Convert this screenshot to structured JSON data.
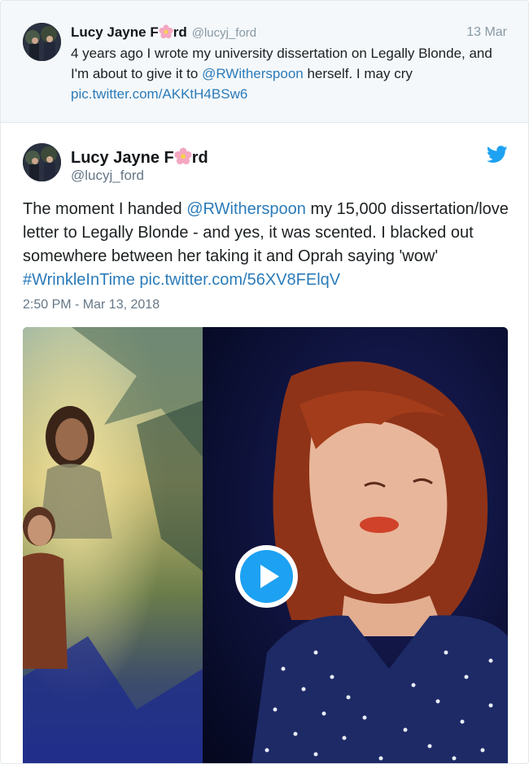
{
  "parent_tweet": {
    "name_before": "Lucy Jayne F",
    "name_after": "rd",
    "handle": "@lucyj_ford",
    "date": "13 Mar",
    "text_1": "4 years ago I wrote my university dissertation on Legally Blonde, and I'm about to give it to ",
    "mention": "@RWitherspoon",
    "text_2": " herself. I may cry",
    "link": "pic.twitter.com/AKKtH4BSw6"
  },
  "main_tweet": {
    "name_before": "Lucy Jayne F",
    "name_after": "rd",
    "handle": "@lucyj_ford",
    "text_1": "The moment I handed ",
    "mention": "@RWitherspoon",
    "text_2": " my 15,000 dissertation/love letter to Legally Blonde - and yes, it was scented. I blacked out somewhere between her taking it and Oprah saying 'wow' ",
    "hashtag": "#WrinkleInTime",
    "link": "pic.twitter.com/56XV8FElqV",
    "timestamp": "2:50 PM - Mar 13, 2018"
  },
  "icons": {
    "twitter": "twitter-bird-icon",
    "play": "play-icon",
    "flower": "flower-emoji-icon"
  },
  "colors": {
    "link": "#2b7bb9",
    "twitter_blue": "#1da1f2",
    "parent_background": "#f5f8fa"
  }
}
